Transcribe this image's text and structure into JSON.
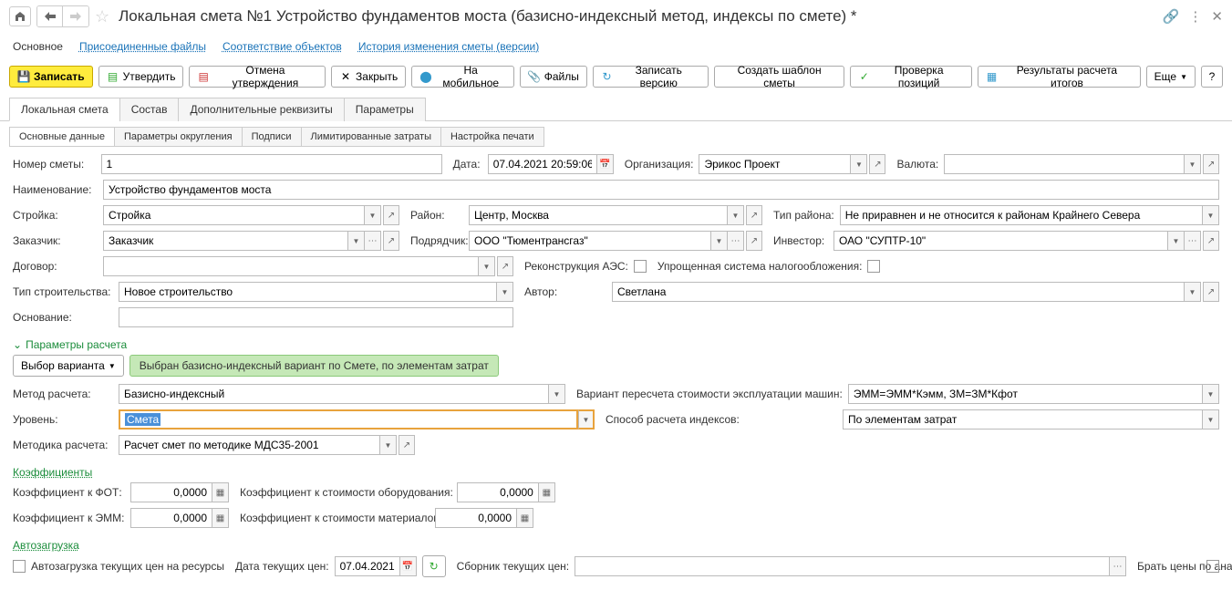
{
  "title": "Локальная смета №1 Устройство фундаментов моста (базисно-индексный метод, индексы по смете) *",
  "nav": {
    "main": "Основное",
    "files": "Присоединенные файлы",
    "corresp": "Соответствие объектов",
    "history": "История изменения сметы (версии)"
  },
  "toolbar": {
    "save": "Записать",
    "approve": "Утвердить",
    "unapprove": "Отмена утверждения",
    "close": "Закрыть",
    "mobile": "На мобильное",
    "files": "Файлы",
    "save_version": "Записать версию",
    "template": "Создать шаблон сметы",
    "check": "Проверка позиций",
    "results": "Результаты расчета итогов",
    "more": "Еще",
    "help": "?"
  },
  "tabs": {
    "local": "Локальная смета",
    "comp": "Состав",
    "extra": "Дополнительные реквизиты",
    "params": "Параметры"
  },
  "subtabs": {
    "basic": "Основные данные",
    "round": "Параметры округления",
    "sign": "Подписи",
    "limit": "Лимитированные затраты",
    "print": "Настройка печати"
  },
  "form": {
    "number_label": "Номер сметы:",
    "number_value": "1",
    "date_label": "Дата:",
    "date_value": "07.04.2021 20:59:06",
    "org_label": "Организация:",
    "org_value": "Эрикос Проект",
    "currency_label": "Валюта:",
    "currency_value": "",
    "name_label": "Наименование:",
    "name_value": "Устройство фундаментов моста",
    "construction_label": "Стройка:",
    "construction_value": "Стройка",
    "region_label": "Район:",
    "region_value": "Центр, Москва",
    "region_type_label": "Тип района:",
    "region_type_value": "Не приравнен и не относится к районам Крайнего Севера",
    "customer_label": "Заказчик:",
    "customer_value": "Заказчик",
    "contractor_label": "Подрядчик:",
    "contractor_value": "ООО \"Тюментрансгаз\"",
    "investor_label": "Инвестор:",
    "investor_value": "ОАО \"СУПТР-10\"",
    "contract_label": "Договор:",
    "recon_label": "Реконструкция АЭС:",
    "simplified_label": "Упрощенная система налогообложения:",
    "build_type_label": "Тип строительства:",
    "build_type_value": "Новое строительство",
    "author_label": "Автор:",
    "author_value": "Светлана",
    "basis_label": "Основание:"
  },
  "calc": {
    "header": "Параметры расчета",
    "variant_btn": "Выбор варианта",
    "variant_badge": "Выбран базисно-индексный вариант по Смете, по элементам затрат",
    "method_label": "Метод расчета:",
    "method_value": "Базисно-индексный",
    "recalc_label": "Вариант пересчета стоимости эксплуатации машин:",
    "recalc_value": "ЭММ=ЭММ*Кэмм, ЗМ=ЗМ*Кфот",
    "level_label": "Уровень:",
    "level_value": "Смета",
    "idx_method_label": "Способ расчета индексов:",
    "idx_method_value": "По элементам затрат",
    "methodology_label": "Методика расчета:",
    "methodology_value": "Расчет смет по методике МДС35-2001"
  },
  "coef": {
    "header": "Коэффициенты",
    "fot_label": "Коэффициент к ФОТ:",
    "fot_value": "0,0000",
    "equip_label": "Коэффициент к стоимости оборудования:",
    "equip_value": "0,0000",
    "emm_label": "Коэффициент к ЭММ:",
    "emm_value": "0,0000",
    "mat_label": "Коэффициент к стоимости материалов:",
    "mat_value": "0,0000"
  },
  "autoload": {
    "header": "Автозагрузка",
    "auto_label": "Автозагрузка текущих цен на ресурсы",
    "date_label": "Дата текущих цен:",
    "date_value": "07.04.2021",
    "collection_label": "Сборник текущих цен:",
    "analog_label": "Брать цены по аналогам:"
  }
}
